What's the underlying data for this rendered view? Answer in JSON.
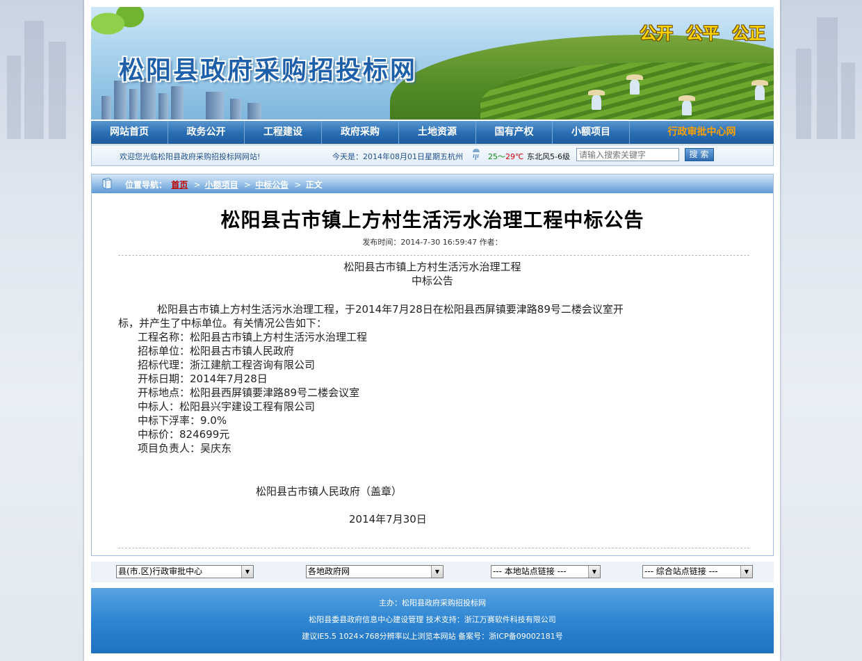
{
  "banner": {
    "site_title": "松阳县政府采购招投标网",
    "slogan": "公开 公平 公正"
  },
  "nav": {
    "items": [
      "网站首页",
      "政务公开",
      "工程建设",
      "政府采购",
      "土地资源",
      "国有产权",
      "小额项目",
      "行政审批中心网"
    ]
  },
  "infobar": {
    "welcome": "欢迎您光临松阳县政府采购招投标网网站!",
    "today": "今天是：2014年08月01日星期五杭州",
    "temp_low": "25",
    "temp_sep": "～",
    "temp_high": "29℃",
    "wind": "东北风5-6级",
    "search_placeholder": "请输入搜索关键字",
    "search_button": "搜索"
  },
  "breadcrumb": {
    "label": "位置导航：",
    "home": "首页",
    "level1": "小额项目",
    "level2": "中标公告",
    "current": "正文",
    "sep": ">"
  },
  "article": {
    "title": "松阳县古市镇上方村生活污水治理工程中标公告",
    "pubinfo": "发布时间：2014-7-30 16:59:47 作者：",
    "head_line1": "松阳县古市镇上方村生活污水治理工程",
    "head_line2": "中标公告",
    "intro_line1": "松阳县古市镇上方村生活污水治理工程，于2014年7月28日在松阳县西屏镇要津路89号二楼会议室开",
    "intro_line2": "标，并产生了中标单位。有关情况公告如下：",
    "fields": [
      "工程名称：松阳县古市镇上方村生活污水治理工程",
      "招标单位：松阳县古市镇人民政府",
      "招标代理：浙江建航工程咨询有限公司",
      "开标日期：2014年7月28日",
      "开标地点：松阳县西屏镇要津路89号二楼会议室",
      "中标人：松阳县兴宇建设工程有限公司",
      "中标下浮率：9.0%",
      "中标价：824699元",
      "项目负责人：吴庆东"
    ],
    "signature": "松阳县古市镇人民政府（盖章）",
    "sign_date": "2014年7月30日"
  },
  "links": {
    "select1": "县(市.区)行政审批中心",
    "select2": "各地政府网",
    "select3": "--- 本地站点链接 ---",
    "select4": "--- 综合站点链接 ---"
  },
  "footer": {
    "line1": "主办：松阳县政府采购招投标网",
    "line2": "松阳县委县政府信息中心建设管理 技术支持：浙江万赛软件科技有限公司",
    "line3": "建议IE5.5 1024×768分辨率以上浏览本网站 备案号：浙ICP备09002181号"
  },
  "colors": {
    "nav_highlight": "#ffa200",
    "breadcrumb_home": "#c00000",
    "temp_low": "#0a8d0a",
    "temp_high": "#d00000"
  }
}
